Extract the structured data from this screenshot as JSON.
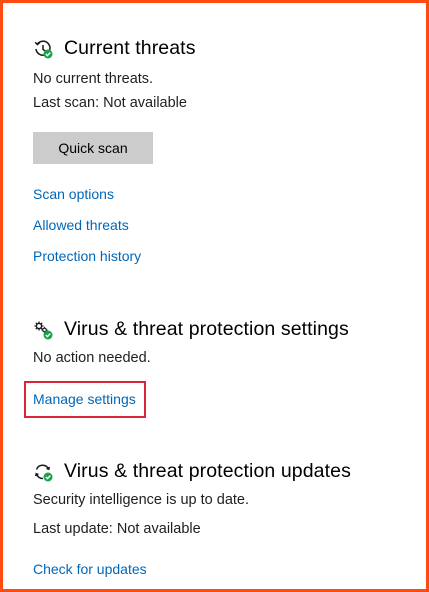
{
  "current_threats": {
    "title": "Current threats",
    "status": "No current threats.",
    "last_scan": "Last scan: Not available",
    "quick_scan_label": "Quick scan",
    "links": {
      "scan_options": "Scan options",
      "allowed_threats": "Allowed threats",
      "protection_history": "Protection history"
    }
  },
  "protection_settings": {
    "title": "Virus & threat protection settings",
    "status": "No action needed.",
    "manage_label": "Manage settings"
  },
  "protection_updates": {
    "title": "Virus & threat protection updates",
    "status": "Security intelligence is up to date.",
    "last_update": "Last update: Not available",
    "check_label": "Check for updates"
  },
  "icons": {
    "current_threats": "history-clock-shield-icon",
    "settings": "gears-shield-icon",
    "updates": "refresh-shield-icon"
  },
  "colors": {
    "link": "#0067b8",
    "button_bg": "#cccccc",
    "status_ok": "#16a34a",
    "frame_border": "#ff4a12",
    "highlight_border": "#d9243a"
  }
}
